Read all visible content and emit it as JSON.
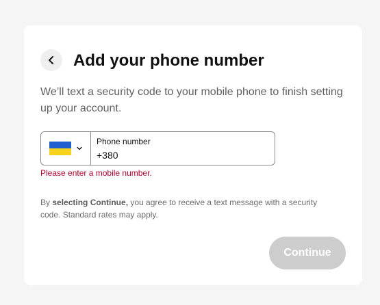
{
  "header": {
    "title": "Add your phone number",
    "back_icon": "chevron-left-icon"
  },
  "subtitle": "We’ll text a security code to your mobile phone to finish setting up your account.",
  "phone": {
    "country_flag": "ukraine-flag",
    "flag_colors": {
      "top": "#1f5fcf",
      "bottom": "#f6d318"
    },
    "dropdown_icon": "chevron-down-icon",
    "label": "Phone number",
    "value": "+380"
  },
  "error": {
    "message": "Please enter a mobile number.",
    "color": "#b0002b"
  },
  "consent": {
    "prefix": "By ",
    "emphasis": "selecting Continue,",
    "suffix": " you agree to receive a text message with a security code. Standard rates may apply."
  },
  "continue_button": {
    "label": "Continue",
    "state": "disabled",
    "background": "#cdcdcd"
  }
}
